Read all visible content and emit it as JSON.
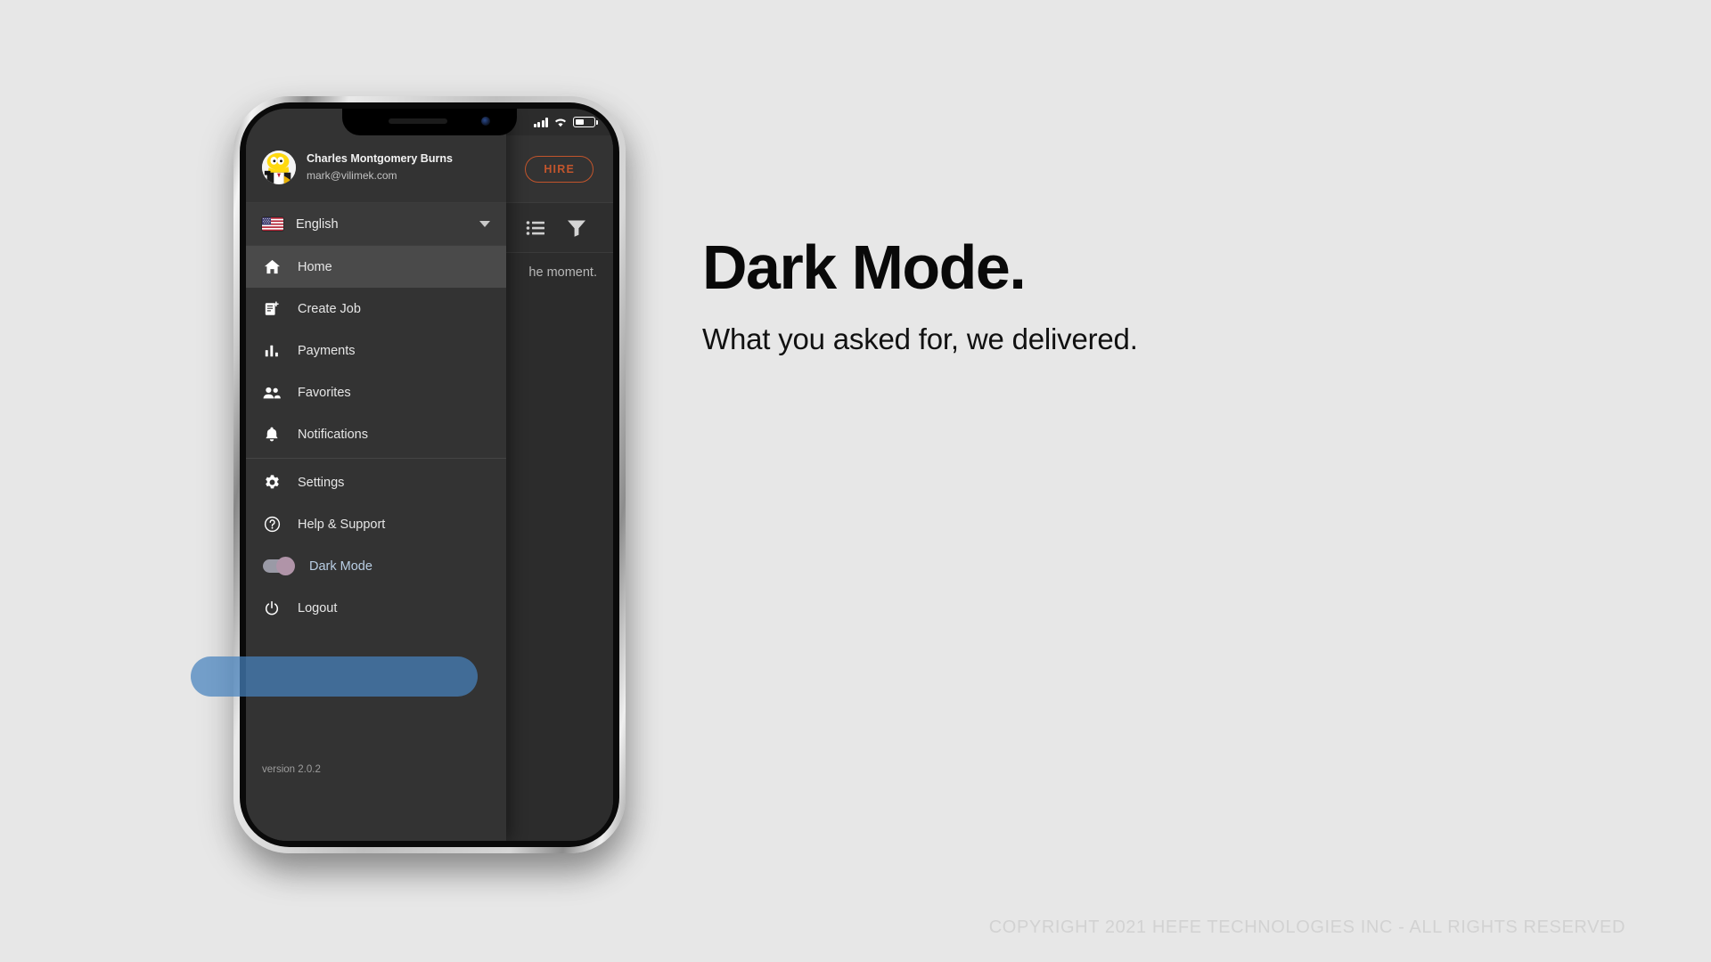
{
  "marketing": {
    "headline": "Dark Mode.",
    "subhead": "What you asked for, we delivered.",
    "copyright": "COPYRIGHT 2021 HEFE TECHNOLOGIES INC - ALL RIGHTS RESERVED"
  },
  "phone": {
    "statusbar": {
      "signal_icon": "signal-bars-icon",
      "wifi_icon": "wifi-icon",
      "battery_icon": "battery-icon",
      "battery_level_percent": 35
    }
  },
  "drawer": {
    "profile": {
      "name": "Charles Montgomery Burns",
      "email": "mark@vilimek.com",
      "avatar_icon": "avatar"
    },
    "language": {
      "label": "English",
      "flag_icon": "us-flag-icon",
      "caret_icon": "chevron-down-icon"
    },
    "menu_items": [
      {
        "label": "Home",
        "icon": "home-icon",
        "active": true
      },
      {
        "label": "Create Job",
        "icon": "create-job-icon",
        "active": false
      },
      {
        "label": "Payments",
        "icon": "bar-chart-icon",
        "active": false
      },
      {
        "label": "Favorites",
        "icon": "people-icon",
        "active": false
      },
      {
        "label": "Notifications",
        "icon": "bell-icon",
        "active": false
      },
      {
        "label": "Settings",
        "icon": "gear-icon",
        "active": false
      },
      {
        "label": "Help & Support",
        "icon": "help-circle-icon",
        "active": false
      }
    ],
    "dark_mode": {
      "label": "Dark Mode",
      "toggle_state": "on",
      "highlight_color": "#4682be"
    },
    "logout": {
      "label": "Logout",
      "icon": "power-icon"
    },
    "version": "version 2.0.2"
  },
  "app_content": {
    "hire_button": "HIRE",
    "hire_button_color": "#c3552c",
    "list_icon": "list-view-icon",
    "filter_icon": "filter-funnel-icon",
    "empty_text": "he moment."
  }
}
